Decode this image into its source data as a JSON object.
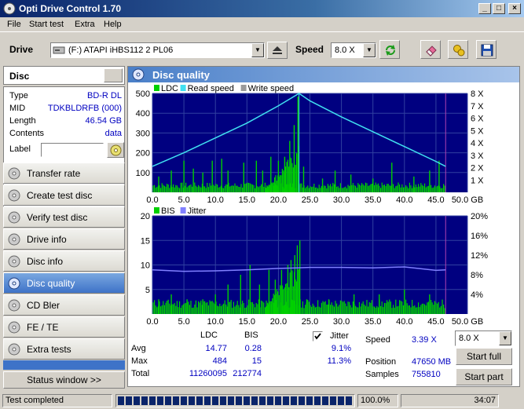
{
  "window": {
    "title": "Opti Drive Control 1.70",
    "min_label": "_",
    "max_label": "□",
    "close_label": "×"
  },
  "menu": [
    "File",
    "Start test",
    "Extra",
    "Help"
  ],
  "toolbar": {
    "drive_label": "Drive",
    "drive_value": "(F:)   ATAPI iHBS112   2 PL06",
    "speed_label": "Speed",
    "speed_value": "8.0 X",
    "icons": [
      "eject-icon",
      "refresh-icon",
      "erase-icon",
      "settings-icon",
      "save-icon"
    ]
  },
  "disc": {
    "header": "Disc",
    "rows": [
      {
        "key": "Type",
        "value": "BD-R DL"
      },
      {
        "key": "MID",
        "value": "TDKBLDRFB (000)"
      },
      {
        "key": "Length",
        "value": "46.54 GB"
      },
      {
        "key": "Contents",
        "value": "data"
      }
    ],
    "label_key": "Label",
    "label_value": ""
  },
  "nav": [
    {
      "label": "Transfer rate",
      "active": false
    },
    {
      "label": "Create test disc",
      "active": false
    },
    {
      "label": "Verify test disc",
      "active": false
    },
    {
      "label": "Drive info",
      "active": false
    },
    {
      "label": "Disc info",
      "active": false
    },
    {
      "label": "Disc quality",
      "active": true
    },
    {
      "label": "CD Bler",
      "active": false
    },
    {
      "label": "FE / TE",
      "active": false
    },
    {
      "label": "Extra tests",
      "active": false
    }
  ],
  "status_window_label": "Status window >>",
  "main": {
    "title": "Disc quality"
  },
  "colors": {
    "ldc": "#00d000",
    "bis": "#00d000",
    "read_speed": "#40e0f0",
    "jitter": "#8080ff",
    "plot_bg": "#000080",
    "accent": "#0000c0"
  },
  "chart_data": [
    {
      "type": "area",
      "legend": [
        "LDC",
        "Read speed",
        "Write speed"
      ],
      "x_ticks": [
        "0.0",
        "5.0",
        "10.0",
        "15.0",
        "20.0",
        "25.0",
        "30.0",
        "35.0",
        "40.0",
        "45.0",
        "50.0 GB"
      ],
      "y_ticks": [
        "500",
        "400",
        "300",
        "200",
        "100"
      ],
      "y2_ticks": [
        "8 X",
        "7 X",
        "6 X",
        "5 X",
        "4 X",
        "3 X",
        "2 X",
        "1 X"
      ],
      "xlim": [
        0,
        50
      ],
      "ylim": [
        0,
        500
      ],
      "y2lim": [
        0,
        8
      ],
      "read_speed": {
        "x": [
          0,
          5,
          10,
          15,
          20,
          23.27,
          25,
          30,
          35,
          40,
          45,
          46.54
        ],
        "y": [
          2.1,
          3.2,
          4.4,
          5.6,
          7.0,
          8.0,
          7.4,
          6.1,
          4.9,
          3.7,
          2.5,
          2.1
        ]
      },
      "ldc_peaks": {
        "x": [
          1,
          3,
          5,
          6.5,
          8,
          9.5,
          11,
          12,
          14.5,
          16.5,
          17.5,
          18.8,
          20,
          21,
          21.8,
          22.5,
          23.1,
          24,
          27,
          29,
          31.5,
          35,
          38,
          41.5,
          44,
          45.5
        ],
        "y": [
          80,
          110,
          160,
          120,
          100,
          160,
          170,
          110,
          150,
          160,
          110,
          180,
          160,
          180,
          260,
          340,
          484,
          130,
          70,
          110,
          90,
          70,
          150,
          80,
          110,
          160
        ]
      }
    },
    {
      "type": "area",
      "legend": [
        "BIS",
        "Jitter"
      ],
      "x_ticks": [
        "0.0",
        "5.0",
        "10.0",
        "15.0",
        "20.0",
        "25.0",
        "30.0",
        "35.0",
        "40.0",
        "45.0",
        "50.0 GB"
      ],
      "y_ticks": [
        "20",
        "15",
        "10",
        "5"
      ],
      "y2_ticks": [
        "20%",
        "16%",
        "12%",
        "8%",
        "4%"
      ],
      "xlim": [
        0,
        50
      ],
      "ylim": [
        0,
        20
      ],
      "y2lim": [
        0,
        20
      ],
      "jitter": {
        "x": [
          0,
          5,
          10,
          15,
          20,
          23,
          25,
          30,
          35,
          40,
          45,
          46.54
        ],
        "y": [
          9.0,
          8.7,
          8.8,
          9.0,
          9.3,
          9.4,
          9.5,
          9.5,
          9.4,
          9.6,
          8.9,
          9.0
        ]
      },
      "bis_peaks": {
        "x": [
          1,
          3,
          5.5,
          8,
          10,
          12,
          14,
          15.5,
          17,
          18.5,
          19.5,
          20.5,
          21.5,
          22,
          22.6,
          23,
          23.4,
          24.5,
          28,
          32,
          36,
          40,
          44
        ],
        "y": [
          3,
          4,
          3,
          3,
          4,
          6,
          8,
          10,
          6,
          9,
          7,
          9,
          10,
          11,
          12,
          14,
          15,
          3,
          3,
          4,
          4,
          5,
          4
        ]
      }
    }
  ],
  "stats": {
    "col_ldc": "LDC",
    "col_bis": "BIS",
    "rows": [
      {
        "label": "Avg",
        "ldc": "14.77",
        "bis": "0.28"
      },
      {
        "label": "Max",
        "ldc": "484",
        "bis": "15"
      },
      {
        "label": "Total",
        "ldc": "11260095",
        "bis": "212774"
      }
    ],
    "jitter_label": "Jitter",
    "jitter_checked": true,
    "jitter_avg": "9.1%",
    "jitter_max": "11.3%",
    "speed_label": "Speed",
    "speed_value": "3.39 X",
    "speed_select": "8.0 X",
    "position_label": "Position",
    "position_value": "47650 MB",
    "samples_label": "Samples",
    "samples_value": "755810",
    "start_full": "Start full",
    "start_part": "Start part"
  },
  "statusbar": {
    "text": "Test completed",
    "progress": 1.0,
    "percent": "100.0%",
    "time": "34:07"
  }
}
